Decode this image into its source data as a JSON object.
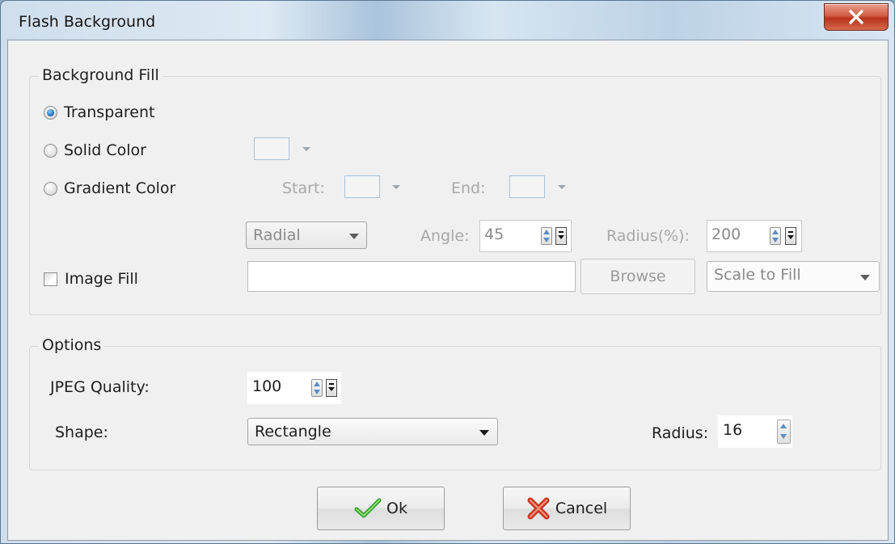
{
  "window": {
    "title": "Flash Background"
  },
  "background_fill": {
    "group_title": "Background Fill",
    "transparent": {
      "label": "Transparent",
      "checked": true
    },
    "solid_color": {
      "label": "Solid Color",
      "checked": false
    },
    "gradient_color": {
      "label": "Gradient Color",
      "checked": false
    },
    "start_label": "Start:",
    "end_label": "End:",
    "gradient_type": "Radial",
    "angle_label": "Angle:",
    "angle_value": "45",
    "radius_pct_label": "Radius(%):",
    "radius_pct_value": "200",
    "image_fill": {
      "label": "Image Fill",
      "checked": false
    },
    "image_path": "",
    "browse_label": "Browse",
    "scale_mode": "Scale to Fill"
  },
  "options": {
    "group_title": "Options",
    "jpeg_quality_label": "JPEG Quality:",
    "jpeg_quality_value": "100",
    "shape_label": "Shape:",
    "shape_value": "Rectangle",
    "radius_label": "Radius:",
    "radius_value": "16"
  },
  "buttons": {
    "ok": "Ok",
    "cancel": "Cancel"
  },
  "icons": {
    "close": "close-icon",
    "ok": "check-icon",
    "cancel": "cross-icon"
  }
}
